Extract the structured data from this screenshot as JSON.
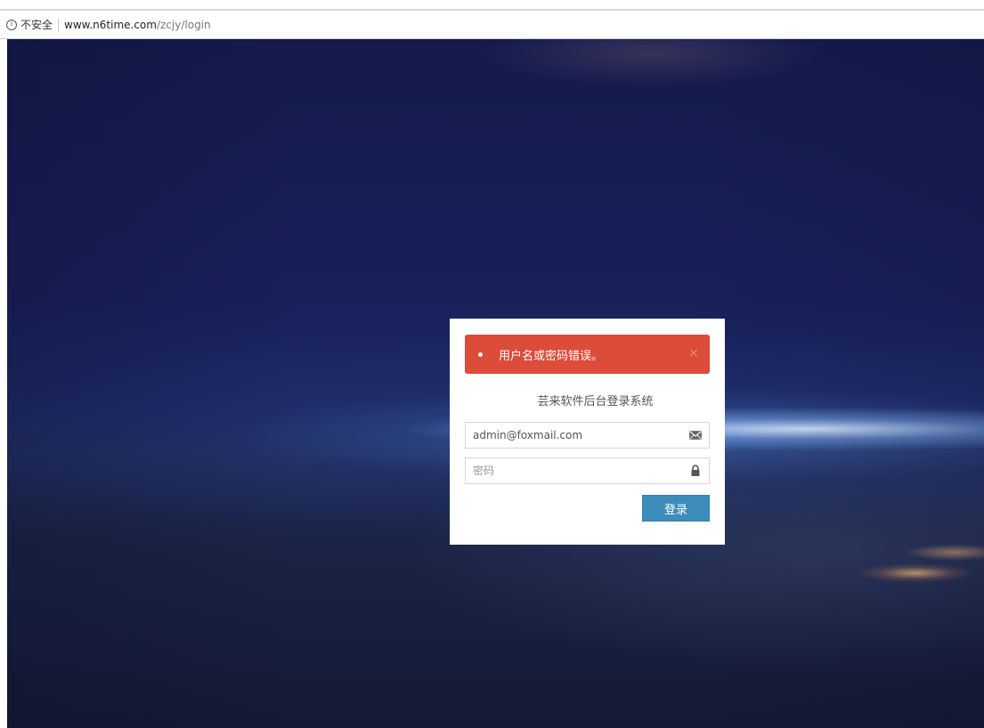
{
  "browser": {
    "info_icon_glyph": "i",
    "security_label": "不安全",
    "url_host": "www.n6time.com",
    "url_path": "/zcjy/login"
  },
  "login": {
    "alert_message": "用户名或密码错误。",
    "alert_close": "×",
    "title": "芸来软件后台登录系统",
    "email_value": "admin@foxmail.com",
    "email_icon": "envelope-icon",
    "password_placeholder": "密码",
    "password_icon": "lock-icon",
    "submit_label": "登录"
  },
  "colors": {
    "alert_bg": "#dd4b39",
    "button_bg": "#3c8dbc",
    "background_space": "#19205a"
  }
}
